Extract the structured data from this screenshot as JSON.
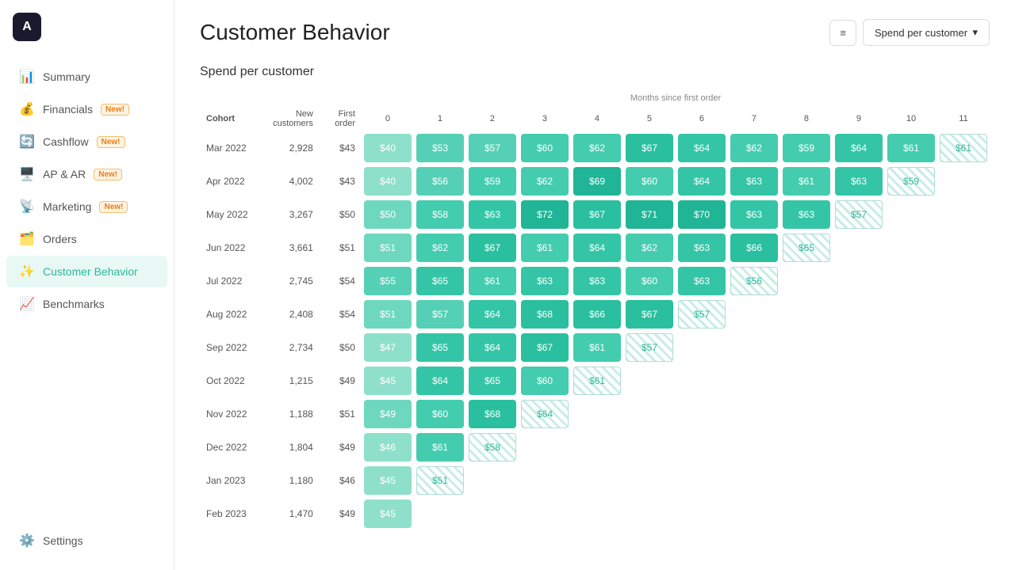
{
  "app": {
    "logo": "A"
  },
  "sidebar": {
    "items": [
      {
        "id": "summary",
        "label": "Summary",
        "icon": "📊",
        "active": false
      },
      {
        "id": "financials",
        "label": "Financials",
        "icon": "💰",
        "badge": "New!",
        "active": false
      },
      {
        "id": "cashflow",
        "label": "Cashflow",
        "icon": "🔄",
        "badge": "New!",
        "active": false
      },
      {
        "id": "ap-ar",
        "label": "AP & AR",
        "icon": "🖥️",
        "badge": "New!",
        "active": false
      },
      {
        "id": "marketing",
        "label": "Marketing",
        "icon": "📡",
        "badge": "New!",
        "active": false
      },
      {
        "id": "orders",
        "label": "Orders",
        "icon": "🗂️",
        "active": false
      },
      {
        "id": "customer-behavior",
        "label": "Customer Behavior",
        "icon": "✨",
        "active": true
      },
      {
        "id": "benchmarks",
        "label": "Benchmarks",
        "icon": "📈",
        "active": false
      },
      {
        "id": "settings",
        "label": "Settings",
        "icon": "⚙️",
        "active": false
      }
    ]
  },
  "page": {
    "title": "Customer Behavior",
    "section_title": "Spend per customer",
    "dropdown_label": "Spend per customer",
    "months_label": "Months since first order"
  },
  "table": {
    "columns": [
      "Cohort",
      "New customers",
      "First order",
      "0",
      "1",
      "2",
      "3",
      "4",
      "5",
      "6",
      "7",
      "8",
      "9",
      "10",
      "11"
    ],
    "rows": [
      {
        "cohort": "Mar 2022",
        "new_customers": "2,928",
        "first_order": "$43",
        "cells": [
          {
            "v": "$40",
            "type": "solid",
            "shade": "light"
          },
          {
            "v": "$53",
            "type": "solid",
            "shade": "med"
          },
          {
            "v": "$57",
            "type": "solid",
            "shade": "med"
          },
          {
            "v": "$60",
            "type": "solid",
            "shade": "med"
          },
          {
            "v": "$62",
            "type": "solid",
            "shade": "med"
          },
          {
            "v": "$67",
            "type": "solid",
            "shade": "dark"
          },
          {
            "v": "$64",
            "type": "solid",
            "shade": "med"
          },
          {
            "v": "$62",
            "type": "solid",
            "shade": "med"
          },
          {
            "v": "$59",
            "type": "solid",
            "shade": "med"
          },
          {
            "v": "$64",
            "type": "solid",
            "shade": "med"
          },
          {
            "v": "$61",
            "type": "solid",
            "shade": "med"
          },
          {
            "v": "$61",
            "type": "hatched"
          }
        ]
      },
      {
        "cohort": "Apr 2022",
        "new_customers": "4,002",
        "first_order": "$43",
        "cells": [
          {
            "v": "$40",
            "type": "solid",
            "shade": "light"
          },
          {
            "v": "$56",
            "type": "solid",
            "shade": "med"
          },
          {
            "v": "$59",
            "type": "solid",
            "shade": "med"
          },
          {
            "v": "$62",
            "type": "solid",
            "shade": "med"
          },
          {
            "v": "$69",
            "type": "solid",
            "shade": "dark"
          },
          {
            "v": "$60",
            "type": "solid",
            "shade": "med"
          },
          {
            "v": "$64",
            "type": "solid",
            "shade": "med"
          },
          {
            "v": "$63",
            "type": "solid",
            "shade": "med"
          },
          {
            "v": "$61",
            "type": "solid",
            "shade": "med"
          },
          {
            "v": "$63",
            "type": "solid",
            "shade": "med"
          },
          {
            "v": "$59",
            "type": "hatched"
          },
          {
            "v": "",
            "type": "empty"
          }
        ]
      },
      {
        "cohort": "May 2022",
        "new_customers": "3,267",
        "first_order": "$50",
        "cells": [
          {
            "v": "$50",
            "type": "solid",
            "shade": "med"
          },
          {
            "v": "$58",
            "type": "solid",
            "shade": "med"
          },
          {
            "v": "$63",
            "type": "solid",
            "shade": "med"
          },
          {
            "v": "$72",
            "type": "solid",
            "shade": "darkest"
          },
          {
            "v": "$67",
            "type": "solid",
            "shade": "dark"
          },
          {
            "v": "$71",
            "type": "solid",
            "shade": "darkest"
          },
          {
            "v": "$70",
            "type": "solid",
            "shade": "dark"
          },
          {
            "v": "$63",
            "type": "solid",
            "shade": "med"
          },
          {
            "v": "$63",
            "type": "solid",
            "shade": "med"
          },
          {
            "v": "$57",
            "type": "hatched"
          },
          {
            "v": "",
            "type": "empty"
          },
          {
            "v": "",
            "type": "empty"
          }
        ]
      },
      {
        "cohort": "Jun 2022",
        "new_customers": "3,661",
        "first_order": "$51",
        "cells": [
          {
            "v": "$51",
            "type": "solid",
            "shade": "med"
          },
          {
            "v": "$62",
            "type": "solid",
            "shade": "med"
          },
          {
            "v": "$67",
            "type": "solid",
            "shade": "dark"
          },
          {
            "v": "$61",
            "type": "solid",
            "shade": "med"
          },
          {
            "v": "$64",
            "type": "solid",
            "shade": "med"
          },
          {
            "v": "$62",
            "type": "solid",
            "shade": "med"
          },
          {
            "v": "$63",
            "type": "solid",
            "shade": "med"
          },
          {
            "v": "$66",
            "type": "solid",
            "shade": "dark"
          },
          {
            "v": "$65",
            "type": "hatched"
          },
          {
            "v": "",
            "type": "empty"
          },
          {
            "v": "",
            "type": "empty"
          },
          {
            "v": "",
            "type": "empty"
          }
        ]
      },
      {
        "cohort": "Jul 2022",
        "new_customers": "2,745",
        "first_order": "$54",
        "cells": [
          {
            "v": "$55",
            "type": "solid",
            "shade": "med"
          },
          {
            "v": "$65",
            "type": "solid",
            "shade": "dark"
          },
          {
            "v": "$61",
            "type": "solid",
            "shade": "med"
          },
          {
            "v": "$63",
            "type": "solid",
            "shade": "med"
          },
          {
            "v": "$63",
            "type": "solid",
            "shade": "med"
          },
          {
            "v": "$60",
            "type": "solid",
            "shade": "med"
          },
          {
            "v": "$63",
            "type": "solid",
            "shade": "med"
          },
          {
            "v": "$56",
            "type": "hatched"
          },
          {
            "v": "",
            "type": "empty"
          },
          {
            "v": "",
            "type": "empty"
          },
          {
            "v": "",
            "type": "empty"
          },
          {
            "v": "",
            "type": "empty"
          }
        ]
      },
      {
        "cohort": "Aug 2022",
        "new_customers": "2,408",
        "first_order": "$54",
        "cells": [
          {
            "v": "$51",
            "type": "solid",
            "shade": "med"
          },
          {
            "v": "$57",
            "type": "solid",
            "shade": "med"
          },
          {
            "v": "$64",
            "type": "solid",
            "shade": "med"
          },
          {
            "v": "$68",
            "type": "solid",
            "shade": "dark"
          },
          {
            "v": "$66",
            "type": "solid",
            "shade": "dark"
          },
          {
            "v": "$67",
            "type": "solid",
            "shade": "dark"
          },
          {
            "v": "$57",
            "type": "hatched"
          },
          {
            "v": "",
            "type": "empty"
          },
          {
            "v": "",
            "type": "empty"
          },
          {
            "v": "",
            "type": "empty"
          },
          {
            "v": "",
            "type": "empty"
          },
          {
            "v": "",
            "type": "empty"
          }
        ]
      },
      {
        "cohort": "Sep 2022",
        "new_customers": "2,734",
        "first_order": "$50",
        "cells": [
          {
            "v": "$47",
            "type": "solid",
            "shade": "light"
          },
          {
            "v": "$65",
            "type": "solid",
            "shade": "dark"
          },
          {
            "v": "$64",
            "type": "solid",
            "shade": "med"
          },
          {
            "v": "$67",
            "type": "solid",
            "shade": "dark"
          },
          {
            "v": "$61",
            "type": "solid",
            "shade": "med"
          },
          {
            "v": "$57",
            "type": "hatched"
          },
          {
            "v": "",
            "type": "empty"
          },
          {
            "v": "",
            "type": "empty"
          },
          {
            "v": "",
            "type": "empty"
          },
          {
            "v": "",
            "type": "empty"
          },
          {
            "v": "",
            "type": "empty"
          },
          {
            "v": "",
            "type": "empty"
          }
        ]
      },
      {
        "cohort": "Oct 2022",
        "new_customers": "1,215",
        "first_order": "$49",
        "cells": [
          {
            "v": "$45",
            "type": "solid",
            "shade": "light"
          },
          {
            "v": "$64",
            "type": "solid",
            "shade": "med"
          },
          {
            "v": "$65",
            "type": "solid",
            "shade": "dark"
          },
          {
            "v": "$60",
            "type": "solid",
            "shade": "med"
          },
          {
            "v": "$61",
            "type": "hatched"
          },
          {
            "v": "",
            "type": "empty"
          },
          {
            "v": "",
            "type": "empty"
          },
          {
            "v": "",
            "type": "empty"
          },
          {
            "v": "",
            "type": "empty"
          },
          {
            "v": "",
            "type": "empty"
          },
          {
            "v": "",
            "type": "empty"
          },
          {
            "v": "",
            "type": "empty"
          }
        ]
      },
      {
        "cohort": "Nov 2022",
        "new_customers": "1,188",
        "first_order": "$51",
        "cells": [
          {
            "v": "$49",
            "type": "solid",
            "shade": "med"
          },
          {
            "v": "$60",
            "type": "solid",
            "shade": "med"
          },
          {
            "v": "$68",
            "type": "solid",
            "shade": "dark"
          },
          {
            "v": "$64",
            "type": "hatched"
          },
          {
            "v": "",
            "type": "empty"
          },
          {
            "v": "",
            "type": "empty"
          },
          {
            "v": "",
            "type": "empty"
          },
          {
            "v": "",
            "type": "empty"
          },
          {
            "v": "",
            "type": "empty"
          },
          {
            "v": "",
            "type": "empty"
          },
          {
            "v": "",
            "type": "empty"
          },
          {
            "v": "",
            "type": "empty"
          }
        ]
      },
      {
        "cohort": "Dec 2022",
        "new_customers": "1,804",
        "first_order": "$49",
        "cells": [
          {
            "v": "$46",
            "type": "solid",
            "shade": "light"
          },
          {
            "v": "$61",
            "type": "solid",
            "shade": "med"
          },
          {
            "v": "$58",
            "type": "hatched"
          },
          {
            "v": "",
            "type": "empty"
          },
          {
            "v": "",
            "type": "empty"
          },
          {
            "v": "",
            "type": "empty"
          },
          {
            "v": "",
            "type": "empty"
          },
          {
            "v": "",
            "type": "empty"
          },
          {
            "v": "",
            "type": "empty"
          },
          {
            "v": "",
            "type": "empty"
          },
          {
            "v": "",
            "type": "empty"
          },
          {
            "v": "",
            "type": "empty"
          }
        ]
      },
      {
        "cohort": "Jan 2023",
        "new_customers": "1,180",
        "first_order": "$46",
        "cells": [
          {
            "v": "$45",
            "type": "solid",
            "shade": "light"
          },
          {
            "v": "$51",
            "type": "hatched"
          },
          {
            "v": "",
            "type": "empty"
          },
          {
            "v": "",
            "type": "empty"
          },
          {
            "v": "",
            "type": "empty"
          },
          {
            "v": "",
            "type": "empty"
          },
          {
            "v": "",
            "type": "empty"
          },
          {
            "v": "",
            "type": "empty"
          },
          {
            "v": "",
            "type": "empty"
          },
          {
            "v": "",
            "type": "empty"
          },
          {
            "v": "",
            "type": "empty"
          },
          {
            "v": "",
            "type": "empty"
          }
        ]
      },
      {
        "cohort": "Feb 2023",
        "new_customers": "1,470",
        "first_order": "$49",
        "cells": [
          {
            "v": "$45",
            "type": "solid",
            "shade": "light"
          },
          {
            "v": "",
            "type": "empty"
          },
          {
            "v": "",
            "type": "empty"
          },
          {
            "v": "",
            "type": "empty"
          },
          {
            "v": "",
            "type": "empty"
          },
          {
            "v": "",
            "type": "empty"
          },
          {
            "v": "",
            "type": "empty"
          },
          {
            "v": "",
            "type": "empty"
          },
          {
            "v": "",
            "type": "empty"
          },
          {
            "v": "",
            "type": "empty"
          },
          {
            "v": "",
            "type": "empty"
          },
          {
            "v": "",
            "type": "empty"
          }
        ]
      }
    ]
  }
}
